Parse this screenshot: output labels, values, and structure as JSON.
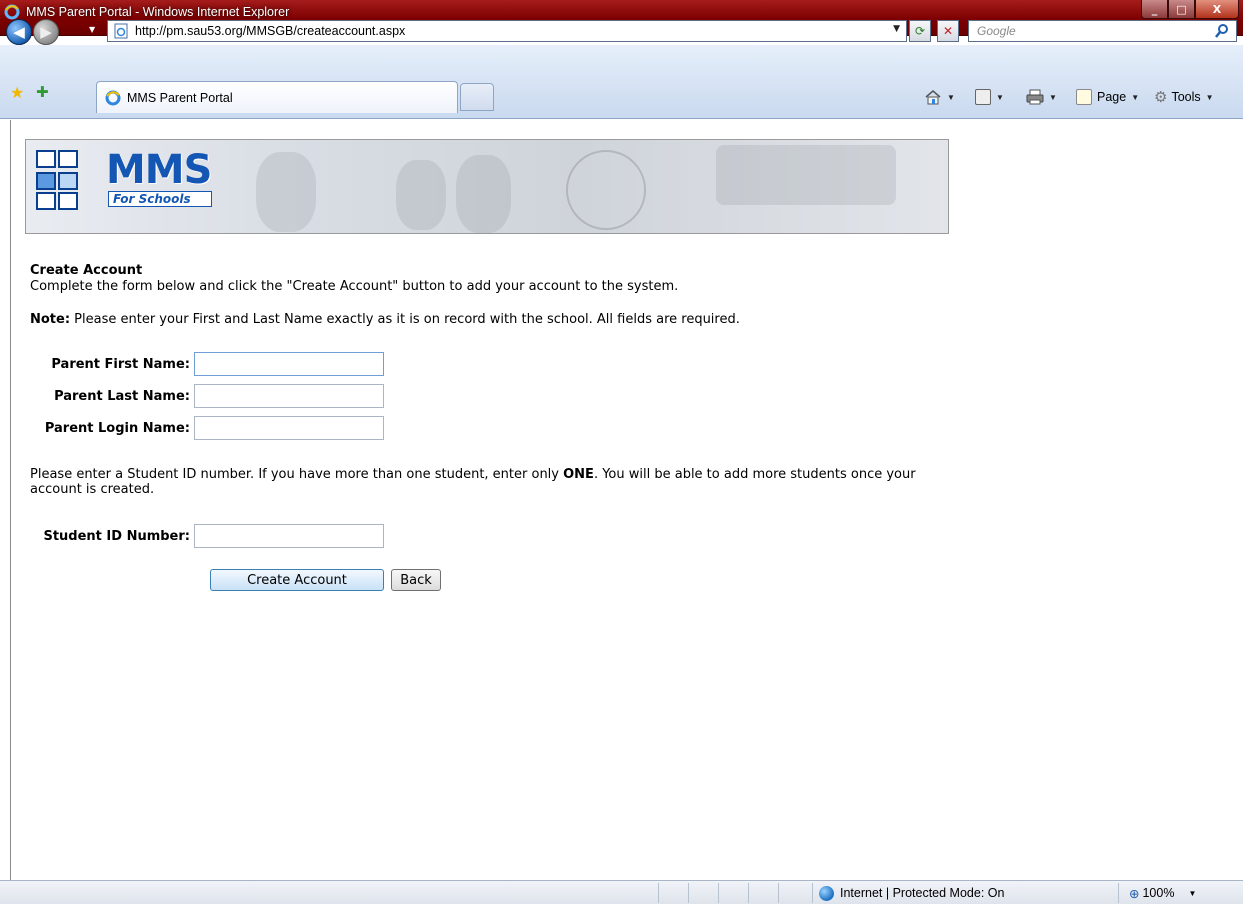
{
  "window": {
    "title": "MMS Parent Portal - Windows Internet Explorer",
    "minimize": "_",
    "maximize": "□",
    "close": "X"
  },
  "browser": {
    "url": "http://pm.sau53.org/MMSGB/createaccount.aspx",
    "search_placeholder": "Google",
    "tab_label": "MMS Parent Portal",
    "commands": {
      "page": "Page",
      "tools": "Tools"
    }
  },
  "logo": {
    "text": "MMS",
    "subtitle": "For Schools"
  },
  "page": {
    "section_title": "Create Account",
    "intro": "Complete the form below and click the \"Create Account\" button to add your account to the system.",
    "note_label": "Note:",
    "note_text": " Please enter your First and Last Name exactly as it is on record with the school. All fields are required.",
    "fields": {
      "first_name_label": "Parent First Name:",
      "first_name_value": "",
      "last_name_label": "Parent Last Name:",
      "last_name_value": "",
      "login_name_label": "Parent Login Name:",
      "login_name_value": "",
      "student_id_label": "Student ID Number:",
      "student_id_value": ""
    },
    "student_note_before": "Please enter a Student ID number. If you have more than one student, enter only ",
    "student_note_bold": "ONE",
    "student_note_after": ". You will be able to add more students once your account is created.",
    "buttons": {
      "create": "Create Account",
      "back": "Back"
    }
  },
  "statusbar": {
    "zone": "Internet | Protected Mode: On",
    "zoom": "100%"
  },
  "colors": {
    "titlebar": "#7d0000",
    "toolbar": "#c9d9ef",
    "logo_blue": "#1356b3"
  }
}
